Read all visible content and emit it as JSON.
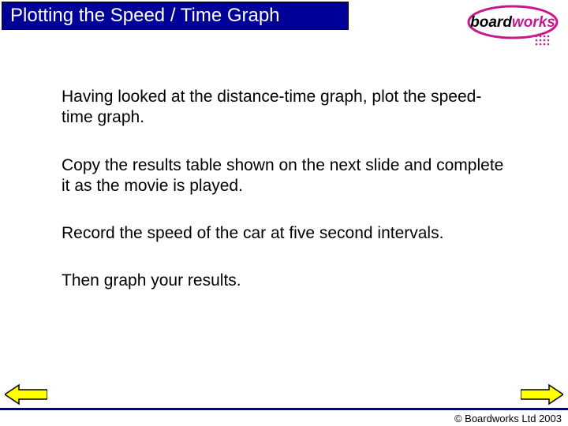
{
  "title": "Plotting the Speed / Time Graph",
  "logo": {
    "brand_prefix": "board",
    "brand_suffix": "works"
  },
  "paragraphs": {
    "p1": "Having looked at the distance-time graph, plot the speed-time graph.",
    "p2": "Copy the results table shown on the next slide and complete it as the movie is played.",
    "p3": "Record the speed of the car at five second intervals.",
    "p4": "Then graph your results."
  },
  "copyright": "© Boardworks Ltd 2003",
  "colors": {
    "accent": "#000099",
    "logo_magenta": "#c31b8e"
  }
}
